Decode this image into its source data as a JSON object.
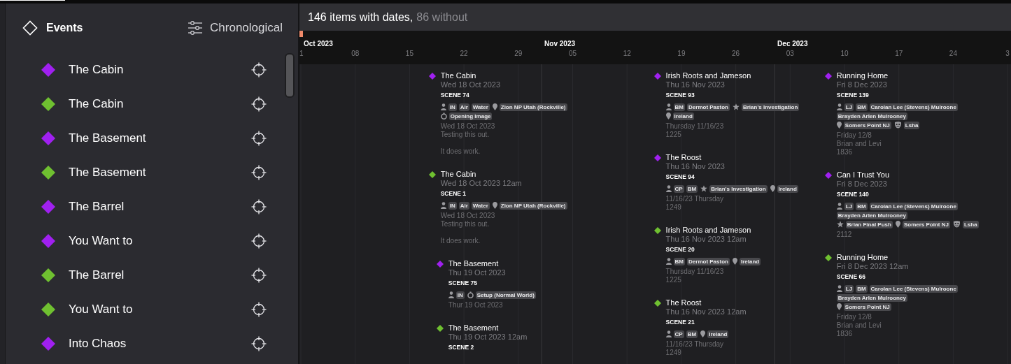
{
  "sidebar": {
    "title": "Events",
    "sort": "Chronological",
    "items": [
      {
        "label": "The Cabin",
        "color": "#a020f0"
      },
      {
        "label": "The Cabin",
        "color": "#6fc030"
      },
      {
        "label": "The Basement",
        "color": "#a020f0"
      },
      {
        "label": "The Basement",
        "color": "#6fc030"
      },
      {
        "label": "The Barrel",
        "color": "#a020f0"
      },
      {
        "label": "You Want to",
        "color": "#a020f0"
      },
      {
        "label": "The Barrel",
        "color": "#6fc030"
      },
      {
        "label": "You Want to",
        "color": "#6fc030"
      },
      {
        "label": "Into Chaos",
        "color": "#a020f0"
      }
    ]
  },
  "timeline": {
    "dated": "146 items with dates,",
    "undated": "86 without",
    "months": [
      {
        "label": "Oct 2023",
        "weeks": [
          "1",
          "08",
          "15",
          "22",
          "29"
        ]
      },
      {
        "label": "Nov 2023",
        "weeks": [
          "05",
          "12",
          "19",
          "26"
        ]
      },
      {
        "label": "Dec 2023",
        "weeks": [
          "03",
          "10",
          "17",
          "24",
          "3"
        ]
      }
    ],
    "columns": [
      {
        "days": [
          {
            "events": [
              {
                "title": "The Cabin",
                "date": "Wed 18 Oct 2023",
                "color": "#a020f0",
                "scene": "SCENE 74",
                "tag_lines": [
                  [
                    {
                      "kind": "person",
                      "tags": [
                        "IN",
                        "Air",
                        "Water"
                      ]
                    },
                    {
                      "kind": "location",
                      "tags": [
                        "Zion NP Utah (Rockville)"
                      ]
                    }
                  ],
                  [
                    {
                      "kind": "timer",
                      "tags": [
                        "Opening Image"
                      ]
                    }
                  ]
                ],
                "notes": [
                  "Wed 18 Oct 2023\nTesting this out.",
                  "It does work."
                ]
              },
              {
                "title": "The Cabin",
                "date": "Wed 18 Oct 2023 12am",
                "color": "#6fc030",
                "scene": "SCENE 1",
                "tag_lines": [
                  [
                    {
                      "kind": "person",
                      "tags": [
                        "IN",
                        "Air",
                        "Water"
                      ]
                    },
                    {
                      "kind": "location",
                      "tags": [
                        "Zion NP Utah (Rockville)"
                      ]
                    }
                  ]
                ],
                "notes": [
                  "Wed 18 Oct 2023\nTesting this out.",
                  "It does work."
                ]
              }
            ]
          },
          {
            "events": [
              {
                "title": "The Basement",
                "date": "Thu 19 Oct 2023",
                "color": "#a020f0",
                "scene": "SCENE 75",
                "tag_lines": [
                  [
                    {
                      "kind": "person",
                      "tags": [
                        "IN"
                      ]
                    },
                    {
                      "kind": "timer",
                      "tags": [
                        "Setup (Normal World)"
                      ]
                    }
                  ]
                ],
                "notes": [
                  "Thur 19 Oct 2023"
                ]
              },
              {
                "title": "The Basement",
                "date": "Thu 19 Oct 2023 12am",
                "color": "#6fc030",
                "scene": "SCENE 2"
              }
            ]
          }
        ]
      },
      {
        "days": [
          {
            "events": [
              {
                "title": "Irish Roots and Jameson",
                "date": "Thu 16 Nov 2023",
                "color": "#a020f0",
                "scene": "SCENE 93",
                "tag_lines": [
                  [
                    {
                      "kind": "person",
                      "tags": [
                        "BM",
                        "Dermot Paston"
                      ]
                    },
                    {
                      "kind": "star",
                      "tags": [
                        "Brian's Investigation"
                      ]
                    }
                  ],
                  [
                    {
                      "kind": "location",
                      "tags": [
                        "Ireland"
                      ]
                    }
                  ]
                ],
                "notes": [
                  "Thursday 11/16/23\n1225"
                ]
              },
              {
                "title": "The Roost",
                "date": "Thu 16 Nov 2023",
                "color": "#a020f0",
                "scene": "SCENE 94",
                "tag_lines": [
                  [
                    {
                      "kind": "person",
                      "tags": [
                        "CP",
                        "BM"
                      ]
                    },
                    {
                      "kind": "star",
                      "tags": [
                        "Brian's Investigation"
                      ]
                    },
                    {
                      "kind": "location",
                      "tags": [
                        "Ireland"
                      ]
                    }
                  ]
                ],
                "notes": [
                  "11/16/23 Thursday\n1249"
                ]
              },
              {
                "title": "Irish Roots and Jameson",
                "date": "Thu 16 Nov 2023 12am",
                "color": "#6fc030",
                "scene": "SCENE 20",
                "tag_lines": [
                  [
                    {
                      "kind": "person",
                      "tags": [
                        "BM",
                        "Dermot Paston"
                      ]
                    },
                    {
                      "kind": "location",
                      "tags": [
                        "Ireland"
                      ]
                    }
                  ]
                ],
                "notes": [
                  "Thursday 11/16/23\n1225"
                ]
              },
              {
                "title": "The Roost",
                "date": "Thu 16 Nov 2023 12am",
                "color": "#6fc030",
                "scene": "SCENE 21",
                "tag_lines": [
                  [
                    {
                      "kind": "person",
                      "tags": [
                        "CP",
                        "BM"
                      ]
                    },
                    {
                      "kind": "location",
                      "tags": [
                        "Ireland"
                      ]
                    }
                  ]
                ],
                "notes": [
                  "11/16/23 Thursday\n1249"
                ]
              }
            ]
          }
        ]
      },
      {
        "days": [
          {
            "events": [
              {
                "title": "Running Home",
                "date": "Fri 8 Dec 2023",
                "color": "#a020f0",
                "scene": "SCENE 139",
                "tag_lines": [
                  [
                    {
                      "kind": "person",
                      "tags": [
                        "LJ",
                        "BM",
                        "Carolan Lee (Stevens) Mulroone"
                      ]
                    }
                  ],
                  [
                    {
                      "kind": "continued",
                      "tags": [
                        "Brayden Arlen Mulrooney"
                      ]
                    }
                  ],
                  [
                    {
                      "kind": "location",
                      "tags": [
                        "Somers Point NJ"
                      ]
                    },
                    {
                      "kind": "mask",
                      "tags": [
                        "Lsha"
                      ]
                    }
                  ]
                ],
                "notes": [
                  "Friday 12/8\nBrian and Levi\n1836"
                ]
              },
              {
                "title": "Can I Trust You",
                "date": "Fri 8 Dec 2023",
                "color": "#a020f0",
                "scene": "SCENE 140",
                "tag_lines": [
                  [
                    {
                      "kind": "person",
                      "tags": [
                        "LJ",
                        "BM",
                        "Carolan Lee (Stevens) Mulroone"
                      ]
                    }
                  ],
                  [
                    {
                      "kind": "continued",
                      "tags": [
                        "Brayden Arlen Mulrooney"
                      ]
                    }
                  ],
                  [
                    {
                      "kind": "star",
                      "tags": [
                        "Brian Final Push"
                      ]
                    },
                    {
                      "kind": "location",
                      "tags": [
                        "Somers Point NJ"
                      ]
                    },
                    {
                      "kind": "mask",
                      "tags": [
                        "Lsha"
                      ]
                    }
                  ]
                ],
                "notes": [
                  "2112"
                ]
              },
              {
                "title": "Running Home",
                "date": "Fri 8 Dec 2023 12am",
                "color": "#6fc030",
                "scene": "SCENE 66",
                "tag_lines": [
                  [
                    {
                      "kind": "person",
                      "tags": [
                        "LJ",
                        "BM",
                        "Carolan Lee (Stevens) Mulroone"
                      ]
                    }
                  ],
                  [
                    {
                      "kind": "continued",
                      "tags": [
                        "Brayden Arlen Mulrooney"
                      ]
                    }
                  ],
                  [
                    {
                      "kind": "location",
                      "tags": [
                        "Somers Point NJ"
                      ]
                    }
                  ]
                ],
                "notes": [
                  "Friday 12/8\nBrian and Levi\n1836"
                ]
              }
            ]
          }
        ]
      }
    ]
  }
}
